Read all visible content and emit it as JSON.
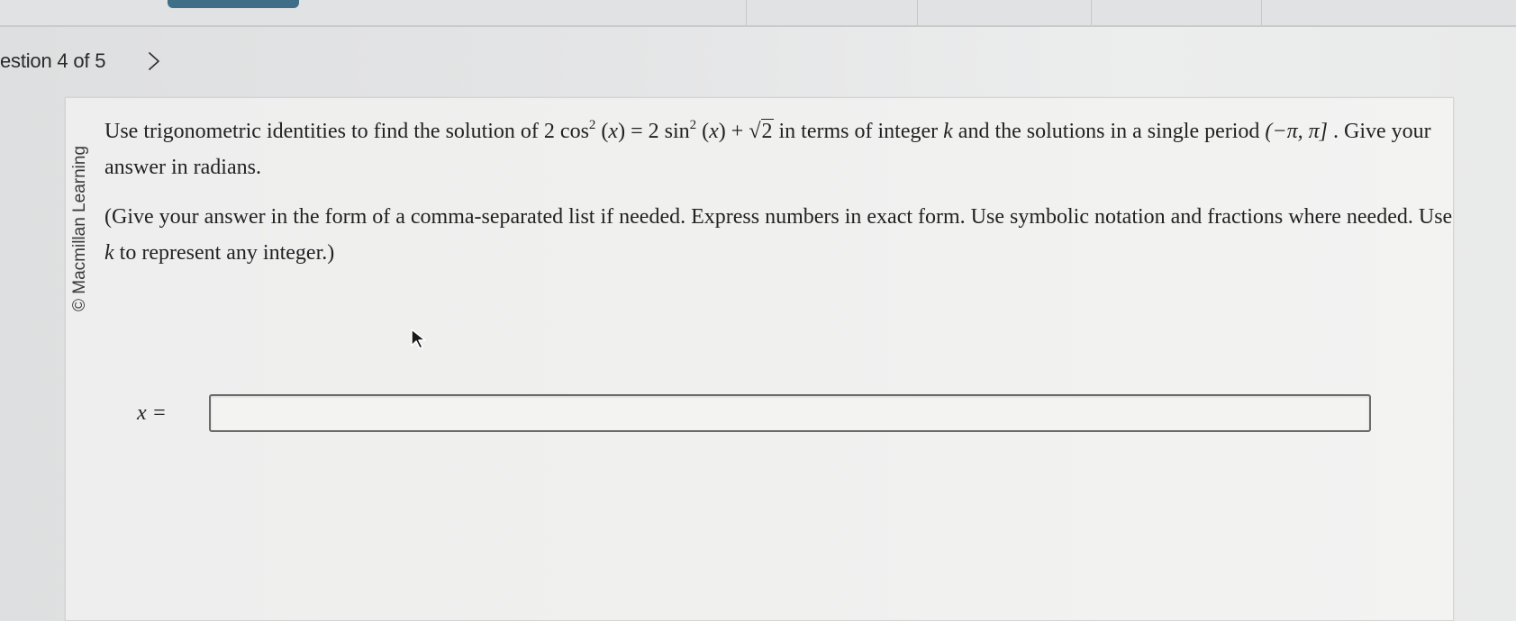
{
  "header": {
    "question_counter": "estion 4 of 5",
    "next_icon": "chevron-right-icon"
  },
  "question": {
    "copyright": "© Macmillan Learning",
    "line1_pre": "Use trigonometric identities to find the solution of 2",
    "cos": "cos",
    "exp": "2",
    "x_paren": "(x)",
    "equals_two": " = 2",
    "sin": "sin",
    "plus": " + ",
    "radicand": "2",
    "line1_post_a": " in terms of integer ",
    "k": "k",
    "line1_post_b": " and the solutions in a single period ",
    "interval": "(−π, π]",
    "line1_end": ". Give your answer in radians.",
    "para2_a": "(Give your answer in the form of a comma-separated list if needed. Express numbers in exact form. Use symbolic notation and fractions where needed. Use ",
    "para2_b": " to represent any integer.)"
  },
  "answer": {
    "label": "x =",
    "value": ""
  },
  "colors": {
    "tab_accent": "#3f6f88",
    "background": "#e4e5e6",
    "card": "#f0f0ef"
  }
}
